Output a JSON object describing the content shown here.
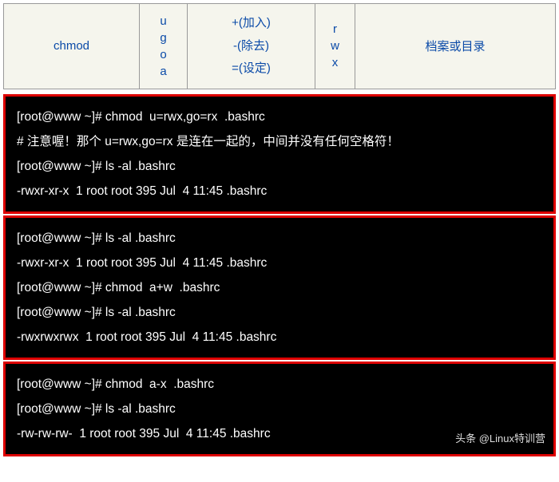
{
  "table": {
    "cmd": "chmod",
    "who": [
      "u",
      "g",
      "o",
      "a"
    ],
    "ops": [
      "+(加入)",
      "-(除去)",
      "=(设定)"
    ],
    "perm": [
      "r",
      "w",
      "x"
    ],
    "target": "档案或目录"
  },
  "blocks": [
    {
      "lines": [
        "[root@www ~]# chmod  u=rwx,go=rx  .bashrc",
        "# 注意喔！那个 u=rwx,go=rx 是连在一起的，中间并没有任何空格符！",
        "[root@www ~]# ls -al .bashrc",
        "-rwxr-xr-x  1 root root 395 Jul  4 11:45 .bashrc"
      ]
    },
    {
      "lines": [
        "[root@www ~]# ls -al .bashrc",
        "-rwxr-xr-x  1 root root 395 Jul  4 11:45 .bashrc",
        "[root@www ~]# chmod  a+w  .bashrc",
        "[root@www ~]# ls -al .bashrc",
        "-rwxrwxrwx  1 root root 395 Jul  4 11:45 .bashrc"
      ]
    },
    {
      "lines": [
        "[root@www ~]# chmod  a-x  .bashrc",
        "[root@www ~]# ls -al .bashrc",
        "-rw-rw-rw-  1 root root 395 Jul  4 11:45 .bashrc"
      ]
    }
  ],
  "watermark": "头条 @Linux特训营"
}
